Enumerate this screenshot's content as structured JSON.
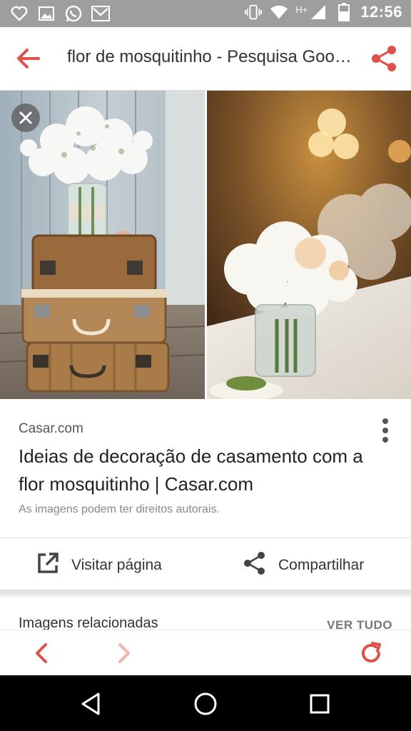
{
  "status_bar": {
    "time": "12:56",
    "network": "H+",
    "icons_left": [
      "heart-icon",
      "image-icon",
      "whatsapp-icon",
      "gmail-icon"
    ],
    "icons_right": [
      "vibrate-icon",
      "wifi-icon",
      "signal-icon",
      "battery-icon"
    ]
  },
  "toolbar": {
    "title": "flor de mosquitinho - Pesquisa Google",
    "accent_color": "#e0504a"
  },
  "result": {
    "source": "Casar.com",
    "headline": "Ideias de decoração de casamento com a flor mosquitinho | Casar.com",
    "rights_notice": "As imagens podem ter direitos autorais.",
    "visit_label": "Visitar página",
    "share_label": "Compartilhar"
  },
  "related": {
    "title": "Imagens relacionadas",
    "see_all": "VER TUDO"
  },
  "colors": {
    "accent": "#e0504a",
    "status_bar": "#9e9e9e"
  }
}
